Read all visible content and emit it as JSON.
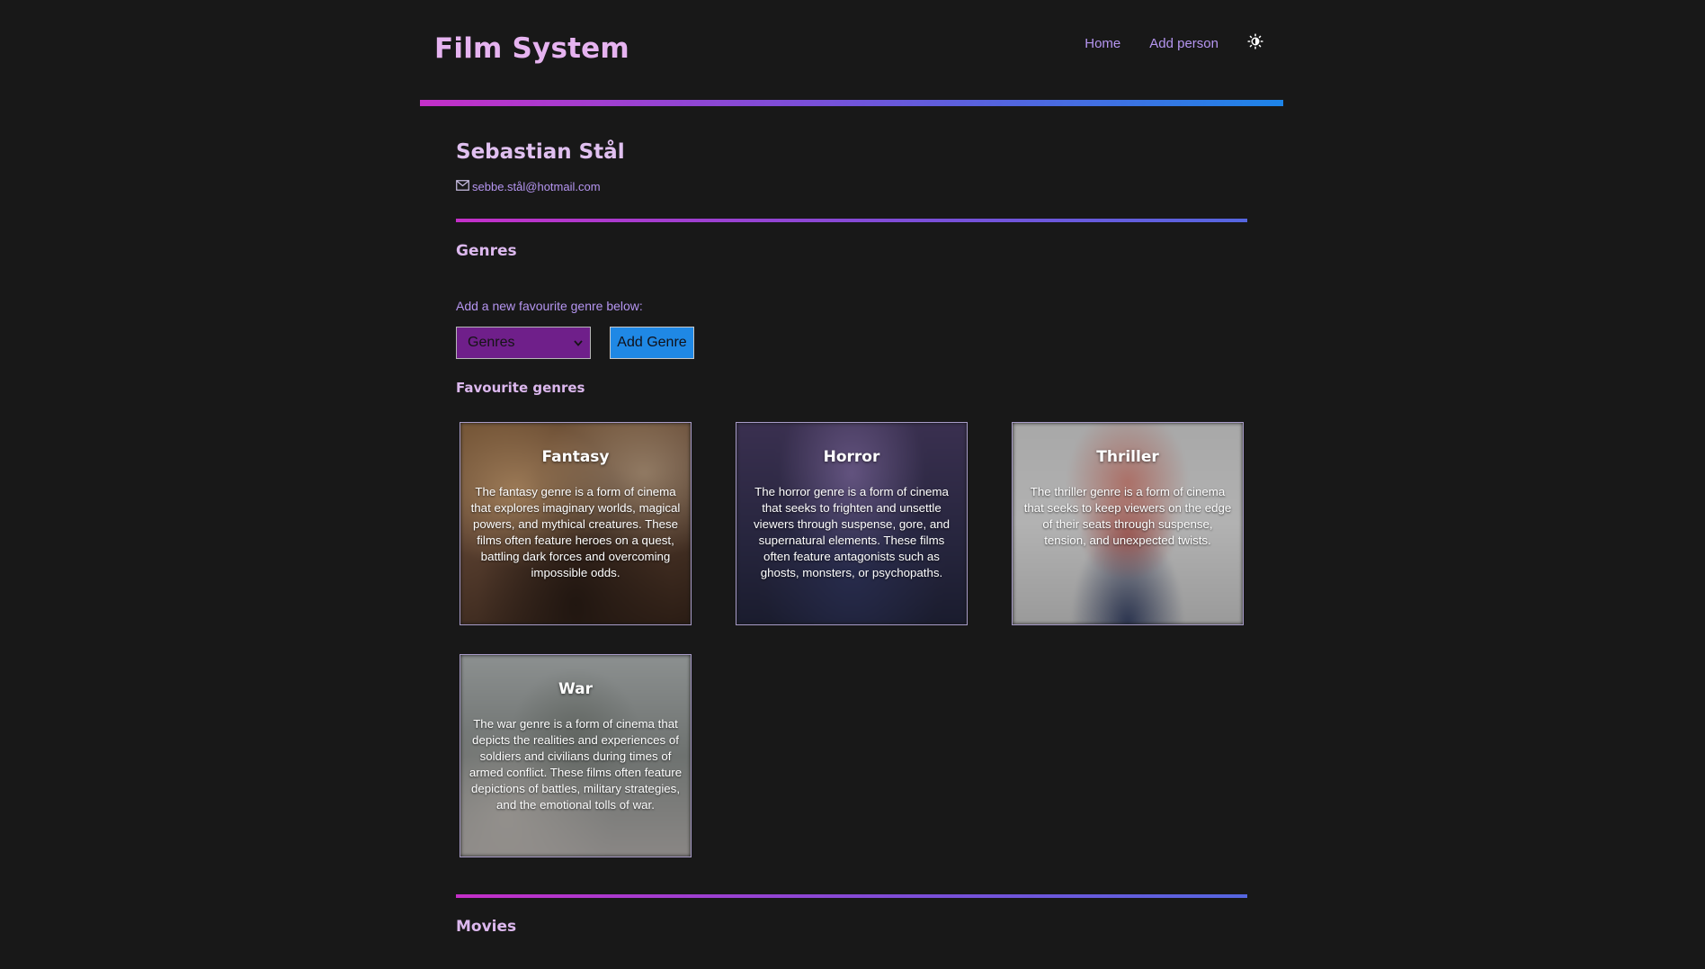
{
  "header": {
    "site_title": "Film System",
    "nav": {
      "home": "Home",
      "add_person": "Add person"
    },
    "theme_toggle_icon": "sun-half-icon"
  },
  "colors": {
    "background": "#181818",
    "accent_pink": "#c42fc8",
    "accent_blue": "#1d84e8",
    "select_bg": "#6f1f8a",
    "button_bg": "#1f88e5"
  },
  "person": {
    "name": "Sebastian Stål",
    "email": "sebbe.stål@hotmail.com",
    "email_icon": "envelope-icon"
  },
  "genres_section": {
    "title": "Genres",
    "add_label": "Add a new favourite genre below:",
    "select_value": "Genres",
    "add_button": "Add Genre",
    "favourites_title": "Favourite genres",
    "cards": [
      {
        "title": "Fantasy",
        "description": "The fantasy genre is a form of cinema that explores imaginary worlds, magical powers, and mythical creatures. These films often feature heroes on a quest, battling dark forces and overcoming impossible odds."
      },
      {
        "title": "Horror",
        "description": "The horror genre is a form of cinema that seeks to frighten and unsettle viewers through suspense, gore, and supernatural elements. These films often feature antagonists such as ghosts, monsters, or psychopaths."
      },
      {
        "title": "Thriller",
        "description": "The thriller genre is a form of cinema that seeks to keep viewers on the edge of their seats through suspense, tension, and unexpected twists."
      },
      {
        "title": "War",
        "description": "The war genre is a form of cinema that depicts the realities and experiences of soldiers and civilians during times of armed conflict. These films often feature depictions of battles, military strategies, and the emotional tolls of war."
      }
    ]
  },
  "movies_section": {
    "title": "Movies"
  }
}
